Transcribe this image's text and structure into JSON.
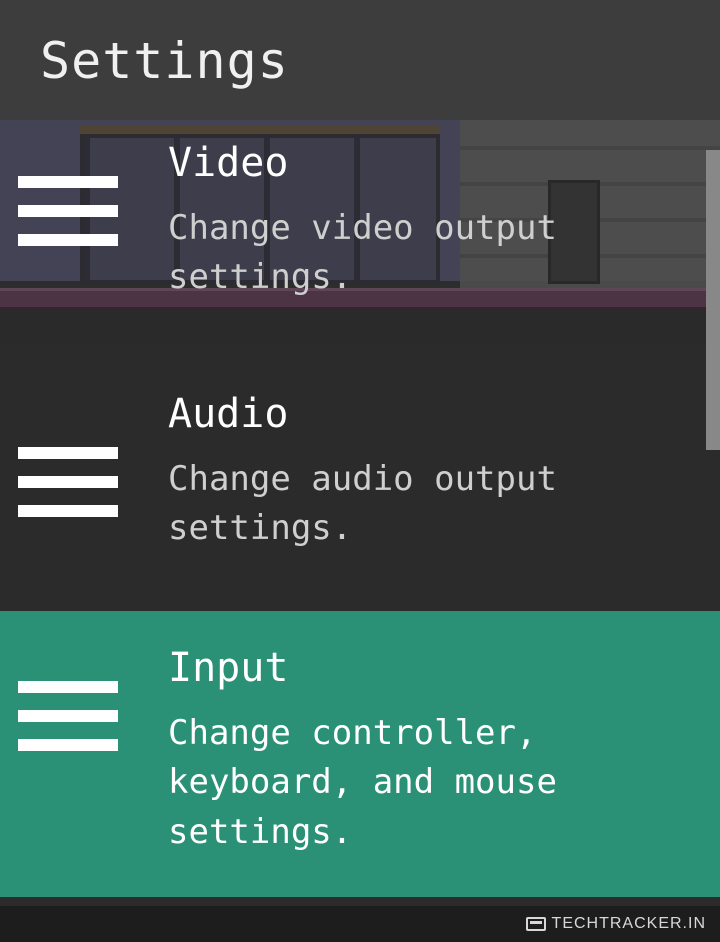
{
  "header": {
    "title": "Settings"
  },
  "menu": {
    "items": [
      {
        "id": "video",
        "title": "Video",
        "desc": "Change video output settings.",
        "selected": false
      },
      {
        "id": "audio",
        "title": "Audio",
        "desc": "Change audio output settings.",
        "selected": false
      },
      {
        "id": "input",
        "title": "Input",
        "desc": "Change controller, keyboard, and mouse settings.",
        "selected": true
      }
    ]
  },
  "footer": {
    "watermark": "TECHTRACKER.IN"
  },
  "colors": {
    "accent": "#2a9176",
    "bg": "#2b2b2b",
    "header": "#3d3d3d"
  }
}
